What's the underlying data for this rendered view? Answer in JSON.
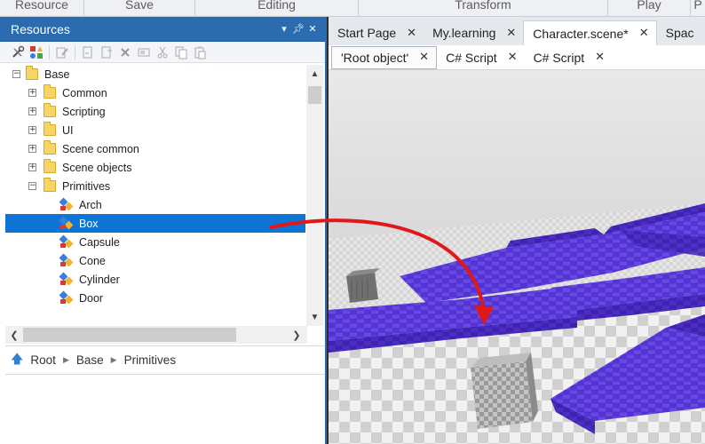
{
  "ribbon": {
    "groups": [
      "Resource",
      "Save",
      "Editing",
      "Transform",
      "Play",
      "P"
    ]
  },
  "resources": {
    "title": "Resources",
    "title_controls": [
      "▾",
      "ᵖ",
      "✕"
    ]
  },
  "toolbar_icons": [
    "wrench-screwdriver-icon",
    "shapes-icon",
    "rename-icon",
    "import-icon",
    "export-icon",
    "delete-icon",
    "properties-icon",
    "cut-icon",
    "copy-icon",
    "paste-icon"
  ],
  "tree": {
    "items": [
      {
        "label": "Base",
        "kind": "folder",
        "expander": "−",
        "level": 0
      },
      {
        "label": "Common",
        "kind": "folder",
        "expander": "+",
        "level": 1
      },
      {
        "label": "Scripting",
        "kind": "folder",
        "expander": "+",
        "level": 1
      },
      {
        "label": "UI",
        "kind": "folder",
        "expander": "+",
        "level": 1
      },
      {
        "label": "Scene common",
        "kind": "folder",
        "expander": "+",
        "level": 1
      },
      {
        "label": "Scene objects",
        "kind": "folder",
        "expander": "+",
        "level": 1
      },
      {
        "label": "Primitives",
        "kind": "folder",
        "expander": "−",
        "level": 1
      },
      {
        "label": "Arch",
        "kind": "primitive",
        "level": 2
      },
      {
        "label": "Box",
        "kind": "primitive",
        "level": 2,
        "selected": true
      },
      {
        "label": "Capsule",
        "kind": "primitive",
        "level": 2
      },
      {
        "label": "Cone",
        "kind": "primitive",
        "level": 2
      },
      {
        "label": "Cylinder",
        "kind": "primitive",
        "level": 2
      },
      {
        "label": "Door",
        "kind": "primitive",
        "level": 2
      }
    ]
  },
  "breadcrumb": {
    "up_icon": "up-arrow-icon",
    "parts": [
      "Root",
      "Base",
      "Primitives"
    ]
  },
  "document_tabs": [
    {
      "label": "Start Page",
      "active": false
    },
    {
      "label": "My.learning",
      "active": false
    },
    {
      "label": "Character.scene*",
      "active": true
    },
    {
      "label": "Spac",
      "active": false
    }
  ],
  "sub_tabs": [
    {
      "label": "'Root object'",
      "active": true
    },
    {
      "label": "C# Script",
      "active": false
    },
    {
      "label": "C# Script",
      "active": false
    }
  ],
  "colors": {
    "accent": "#2b6cb0",
    "selection": "#0d74d6",
    "scene_blocks": "#5534d6",
    "drag_arrow": "#e01818"
  },
  "close_glyph": "✕"
}
